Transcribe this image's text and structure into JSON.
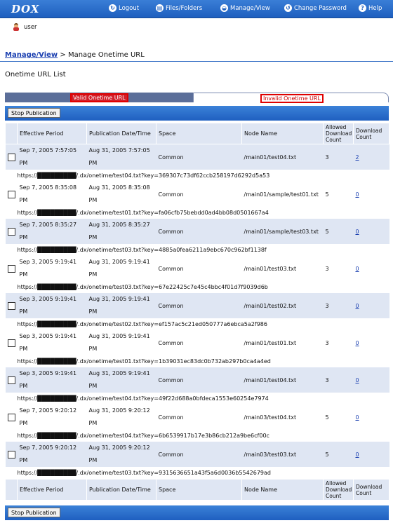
{
  "header": {
    "logo": "DOX",
    "nav": [
      {
        "label": "Logout",
        "icon": "logout-icon"
      },
      {
        "label": "Files/Folders",
        "icon": "files-icon"
      },
      {
        "label": "Manage/View",
        "icon": "manage-icon"
      },
      {
        "label": "Change Password",
        "icon": "password-icon"
      },
      {
        "label": "Help",
        "icon": "help-icon"
      }
    ]
  },
  "user": {
    "name": "user"
  },
  "breadcrumb": {
    "link": "Manage/View",
    "separator": ">",
    "current": "Manage Onetime URL"
  },
  "page_title": "Onetime URL List",
  "tabs": {
    "valid": "Valid Onetime URL",
    "invalid": "Invalid Onetime URL"
  },
  "toolbar": {
    "stop_label": "Stop Publication"
  },
  "columns": [
    "Effective Period",
    "Publication Date/Time",
    "Space",
    "Node Name",
    "Allowed Download Count",
    "Download Count"
  ],
  "rows": [
    {
      "period1": "Sep 7, 2005 7:57:05",
      "period2": "PM",
      "pub1": "Aug 31, 2005 7:57:05",
      "pub2": "PM",
      "space": "Common",
      "node": "/main01/test04.txt",
      "allowed": "3",
      "count": "2",
      "link": true,
      "url": "https://█████████/.dx/onetime/test04.txt?key=369307c73df62ccb258197d6292d5a53"
    },
    {
      "period1": "Sep 7, 2005 8:35:08",
      "period2": "PM",
      "pub1": "Aug 31, 2005 8:35:08",
      "pub2": "PM",
      "space": "Common",
      "node": "/main01/sample/test01.txt",
      "allowed": "5",
      "count": "0",
      "link": true,
      "url": "https://█████████/.dx/onetime/test01.txt?key=fa06cfb75bebdd0ad4bb08d0501667a4"
    },
    {
      "period1": "Sep 7, 2005 8:35:27",
      "period2": "PM",
      "pub1": "Aug 31, 2005 8:35:27",
      "pub2": "PM",
      "space": "Common",
      "node": "/main01/sample/test03.txt",
      "allowed": "5",
      "count": "0",
      "link": true,
      "url": "https://█████████/.dx/onetime/test03.txt?key=4885a0fea6211a9ebc670c962bf1138f"
    },
    {
      "period1": "Sep 3, 2005 9:19:41",
      "period2": "PM",
      "pub1": "Aug 31, 2005 9:19:41",
      "pub2": "PM",
      "space": "Common",
      "node": "/main01/test03.txt",
      "allowed": "3",
      "count": "0",
      "link": true,
      "url": "https://█████████/.dx/onetime/test03.txt?key=67e22425c7e45c4bbc4f01d7f9039d6b"
    },
    {
      "period1": "Sep 3, 2005 9:19:41",
      "period2": "PM",
      "pub1": "Aug 31, 2005 9:19:41",
      "pub2": "PM",
      "space": "Common",
      "node": "/main01/test02.txt",
      "allowed": "3",
      "count": "0",
      "link": true,
      "url": "https://█████████/.dx/onetime/test02.txt?key=ef157ac5c21ed050777a6ebca5a2f986"
    },
    {
      "period1": "Sep 3, 2005 9:19:41",
      "period2": "PM",
      "pub1": "Aug 31, 2005 9:19:41",
      "pub2": "PM",
      "space": "Common",
      "node": "/main01/test01.txt",
      "allowed": "3",
      "count": "0",
      "link": true,
      "url": "https://█████████/.dx/onetime/test01.txt?key=1b39031ec83dc0b732ab297b0ca4a4ed"
    },
    {
      "period1": "Sep 3, 2005 9:19:41",
      "period2": "PM",
      "pub1": "Aug 31, 2005 9:19:41",
      "pub2": "PM",
      "space": "Common",
      "node": "/main01/test04.txt",
      "allowed": "3",
      "count": "0",
      "link": true,
      "url": "https://█████████/.dx/onetime/test04.txt?key=49f22d688a0bfdeca1553e60254e7974"
    },
    {
      "period1": "Sep 7, 2005 9:20:12",
      "period2": "PM",
      "pub1": "Aug 31, 2005 9:20:12",
      "pub2": "PM",
      "space": "Common",
      "node": "/main03/test04.txt",
      "allowed": "5",
      "count": "0",
      "link": true,
      "url": "https://█████████/.dx/onetime/test04.txt?key=6b6539917b17e3b86cb212a9be6cf00c"
    },
    {
      "period1": "Sep 7, 2005 9:20:12",
      "period2": "PM",
      "pub1": "Aug 31, 2005 9:20:12",
      "pub2": "PM",
      "space": "Common",
      "node": "/main03/test03.txt",
      "allowed": "5",
      "count": "0",
      "link": true,
      "url": "https://█████████/.dx/onetime/test03.txt?key=9315636651a43f5a6d0036b5542679ad"
    }
  ]
}
